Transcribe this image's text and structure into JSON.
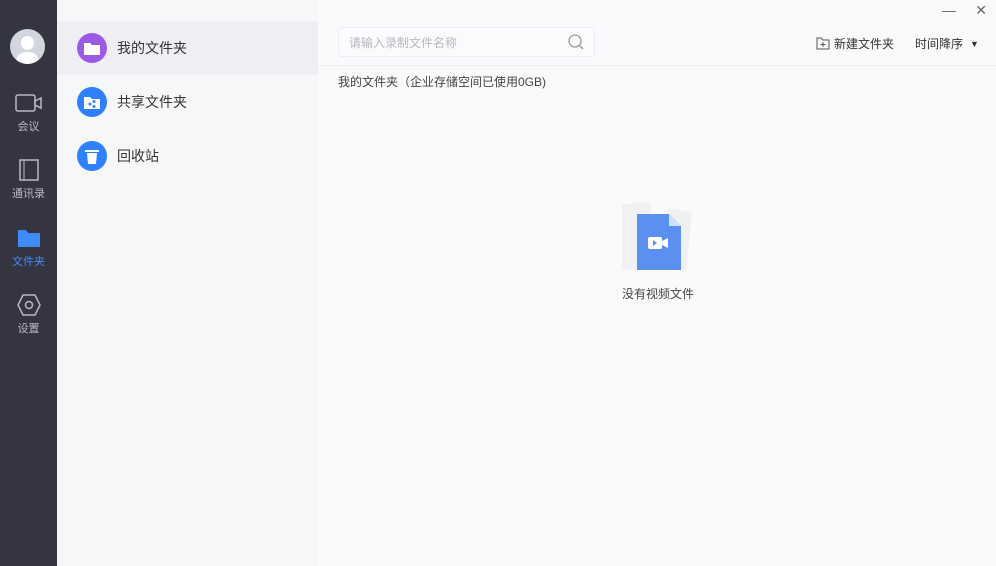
{
  "rail": {
    "items": [
      {
        "label": "会议",
        "icon": "video-camera-icon"
      },
      {
        "label": "通讯录",
        "icon": "contacts-icon"
      },
      {
        "label": "文件夹",
        "icon": "folder-icon"
      },
      {
        "label": "设置",
        "icon": "gear-icon"
      }
    ],
    "active": "文件夹",
    "accent": "#3d8bff"
  },
  "folders": [
    {
      "label": "我的文件夹",
      "color": "#9b59e6"
    },
    {
      "label": "共享文件夹",
      "color": "#2f80ff"
    },
    {
      "label": "回收站",
      "color": "#2f80ff"
    }
  ],
  "search": {
    "placeholder": "请输入录制文件名称"
  },
  "toolbar": {
    "new_folder": "新建文件夹",
    "sort": "时间降序"
  },
  "breadcrumb": "我的文件夹（企业存储空间已使用0GB)",
  "empty": {
    "text": "没有视频文件"
  }
}
